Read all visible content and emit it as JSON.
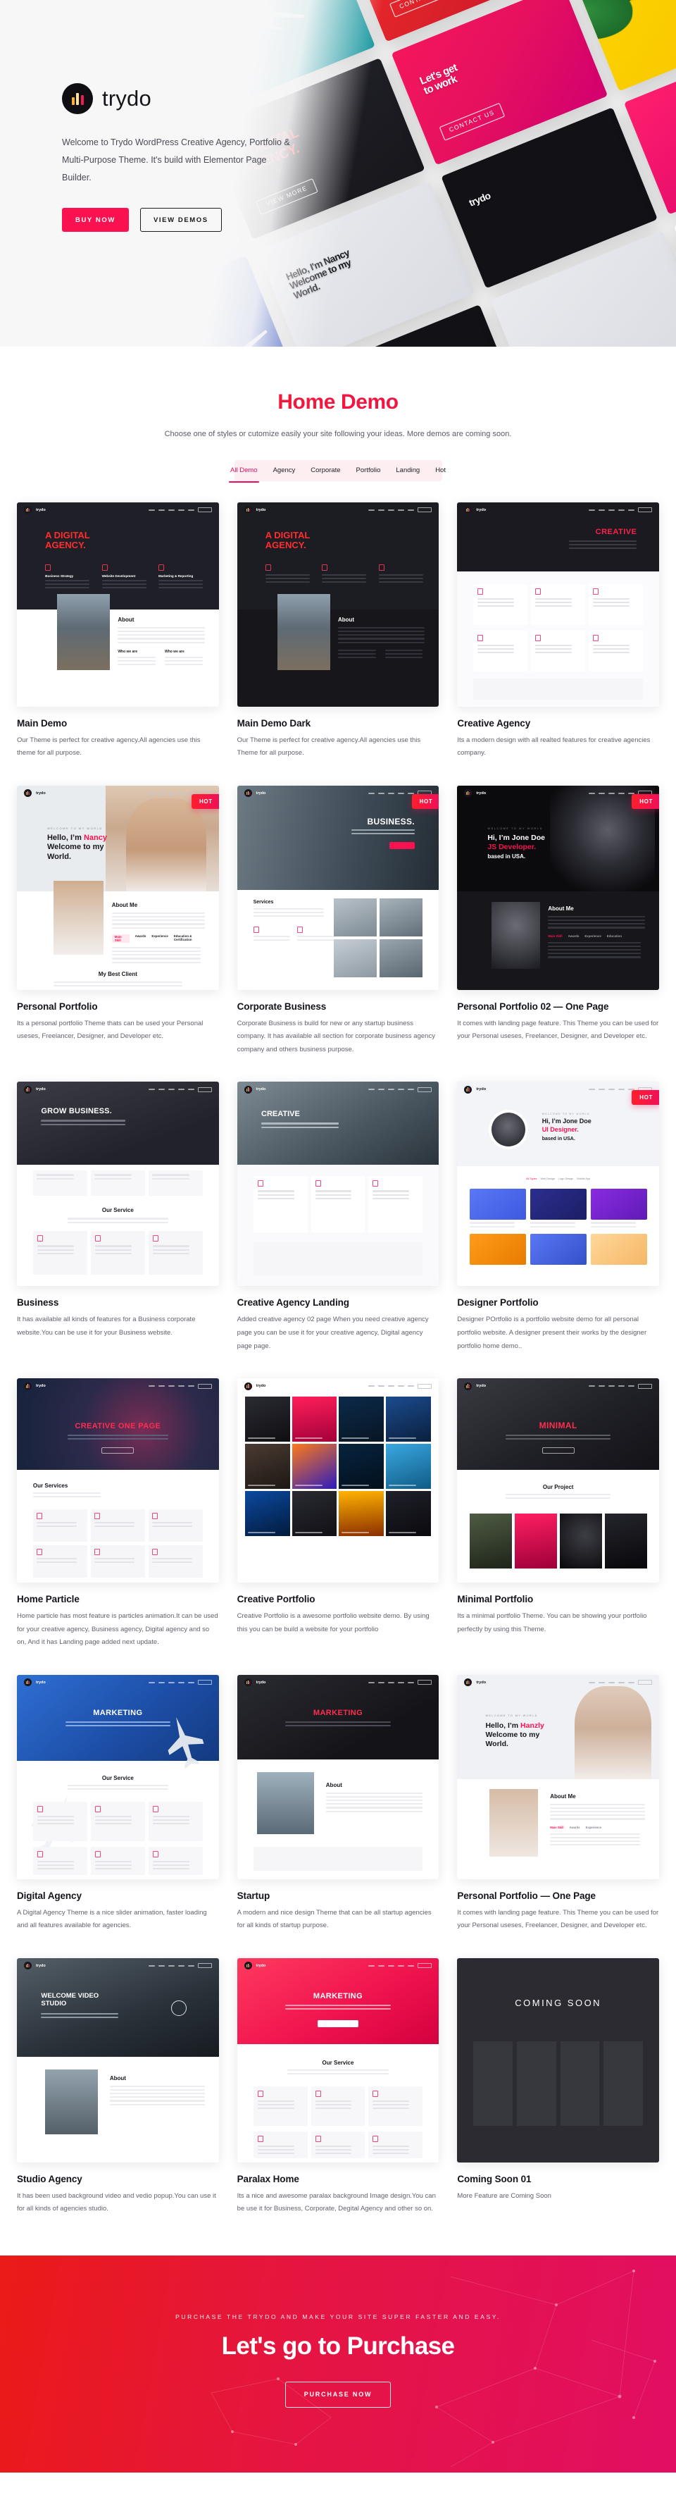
{
  "hero": {
    "brand_name": "trydo",
    "logo_icon": "trydo-bars-logo",
    "description": "Welcome to Trydo WordPress Creative Agency, Portfolio & Multi-Purpose Theme. It's build with Elementor Page Builder.",
    "buy_label": "BUY NOW",
    "demos_label": "VIEW DEMOS",
    "accent": "#f9124f"
  },
  "demo": {
    "title": "Home Demo",
    "subtitle": "Choose one of styles or cutomize easily your site following your ideas. More demos are coming soon.",
    "filters": [
      {
        "label": "All Demo",
        "active": true
      },
      {
        "label": "Agency",
        "active": false
      },
      {
        "label": "Corporate",
        "active": false
      },
      {
        "label": "Portfolio",
        "active": false
      },
      {
        "label": "Landing",
        "active": false
      },
      {
        "label": "Hot",
        "active": false
      }
    ],
    "hot_badge": "HOT",
    "cards": [
      {
        "title": "Main Demo",
        "desc": "Our Theme is perfect for creative agency.All agencies use this theme for all purpose.",
        "hot": false,
        "preview": {
          "style": "dark-agency",
          "headline": "A DIGITAL AGENCY.",
          "section": "About"
        }
      },
      {
        "title": "Main Demo Dark",
        "desc": "Our Theme is perfect for creative agency.All agencies use this Theme for all purpose.",
        "hot": false,
        "preview": {
          "style": "dark-agency-dark",
          "headline": "A DIGITAL AGENCY.",
          "section": "About"
        }
      },
      {
        "title": "Creative Agency",
        "desc": "Its a modern design with all realted features for creative agencies company.",
        "hot": false,
        "preview": {
          "style": "creative-light",
          "headline": "CREATIVE",
          "section": ""
        }
      },
      {
        "title": "Personal Portfolio",
        "desc": "Its a personal portfolio Theme thats can be used your Personal useses, Freelancer, Designer, and Developer etc.",
        "hot": true,
        "preview": {
          "style": "nancy",
          "headline": "Hello, I'm Nancy Welcome to my World.",
          "section": "About Me",
          "section2": "My Best Client"
        }
      },
      {
        "title": "Corporate Business",
        "desc": "Corporate Business is build for new or any startup business company. It has available all section for corporate business agency company and others business purpose.",
        "hot": true,
        "preview": {
          "style": "corporate",
          "headline": "BUSINESS.",
          "section": "Services"
        }
      },
      {
        "title": "Personal Portfolio 02 — One Page",
        "desc": "It comes with landing page feature. This Theme you can be used for your Personal useses, Freelancer, Designer, and Developer etc.",
        "hot": true,
        "preview": {
          "style": "jone-dark",
          "headline": "Hi, I'm Jone Doe JS Developer. based in USA.",
          "section": "About Me"
        }
      },
      {
        "title": "Business",
        "desc": "It has available all kinds of features for a Business corporate website.You can be use it for your Business website.",
        "hot": false,
        "preview": {
          "style": "grow-business",
          "headline": "GROW BUSINESS.",
          "section": "Our Service"
        }
      },
      {
        "title": "Creative Agency Landing",
        "desc": "Added creative agency 02 page When you need creative agency page you can be use it for your creative agency, Digital agency page page.",
        "hot": false,
        "preview": {
          "style": "creative-photo",
          "headline": "CREATIVE",
          "section": ""
        }
      },
      {
        "title": "Designer Portfolio",
        "desc": "Designer POrtfolio is a portfolio website demo for all personal portfolio website. A designer present their works by the designer portfolio home demo..",
        "hot": true,
        "preview": {
          "style": "ui-designer",
          "headline": "Hi, I'm Jone Doe UI Designer. based in USA.",
          "section": ""
        }
      },
      {
        "title": "Home Particle",
        "desc": "Home particle has most feature is particles animation.It can be used for your creative agency, Business agency, Digital agency and so on, And it has Landing page added next update.",
        "hot": false,
        "preview": {
          "style": "particle",
          "headline": "CREATIVE ONE PAGE",
          "section": "Our Services"
        }
      },
      {
        "title": "Creative Portfolio",
        "desc": "Creative Portfolio is a awesome portfolio website demo. By using this you can be build a website for your portfolio",
        "hot": false,
        "preview": {
          "style": "portfolio-grid",
          "headline": "",
          "section": ""
        }
      },
      {
        "title": "Minimal Portfolio",
        "desc": "Its a minimal portfolio Theme. You can be showing your portfolio perfectly by using this Theme.",
        "hot": false,
        "preview": {
          "style": "minimal",
          "headline": "MINIMAL",
          "section": "Our Project"
        }
      },
      {
        "title": "Digital Agency",
        "desc": "A Digital Agency Theme is a nice slider animation, faster loading and all features available for agencies.",
        "hot": false,
        "preview": {
          "style": "marketing-blue",
          "headline": "MARKETING",
          "section": "Our Service"
        }
      },
      {
        "title": "Startup",
        "desc": "A modern and nice design Theme that can be all startup agencies for all kinds of startup purpose.",
        "hot": false,
        "preview": {
          "style": "marketing-dark",
          "headline": "MARKETING",
          "section": "About"
        }
      },
      {
        "title": "Personal Portfolio — One Page",
        "desc": "It comes with landing page feature. This Theme you can be used for your Personal useses, Freelancer, Designer, and Developer etc.",
        "hot": false,
        "preview": {
          "style": "hanzly",
          "headline": "Hello, I'm Hanzly Welcome to my World.",
          "section": "About Me"
        }
      },
      {
        "title": "Studio Agency",
        "desc": "It has been used background video and vedio popup.You can use it for all kinds of agencies studio.",
        "hot": false,
        "preview": {
          "style": "studio",
          "headline": "WELCOME VIDEO STUDIO",
          "section": "About"
        }
      },
      {
        "title": "Paralax Home",
        "desc": "Its a nice and awesome paralax background Image design.You can be use it for Business, Corporate, Degital Agency and other so on.",
        "hot": false,
        "preview": {
          "style": "paralax",
          "headline": "MARKETING",
          "section": "Our Service"
        }
      },
      {
        "title": "Coming Soon 01",
        "desc": "More Feature are Coming Soon",
        "hot": false,
        "preview": {
          "style": "coming-soon",
          "headline": "COMING SOON",
          "section": ""
        }
      }
    ]
  },
  "cta": {
    "kicker": "PURCHASE THE TRYDO AND MAKE YOUR SITE SUPER FASTER AND EASY.",
    "title": "Let's go to Purchase",
    "button": "PURCHASE NOW"
  }
}
